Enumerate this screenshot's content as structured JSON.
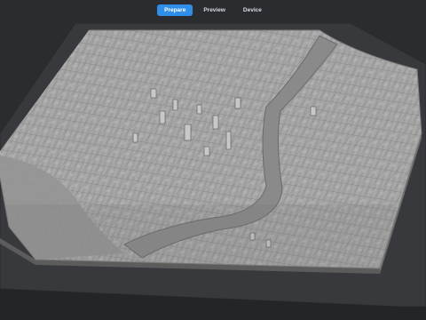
{
  "toolbar": {
    "tabs": [
      {
        "label": "Prepare",
        "active": true
      },
      {
        "label": "Preview",
        "active": false
      },
      {
        "label": "Device",
        "active": false
      }
    ]
  },
  "colors": {
    "background": "#2b2c30",
    "build_plate": "#3a3b3f",
    "plate_edge": "#222326",
    "model_surface": "#a3a3a3",
    "model_shadow": "#6d6d6d",
    "accent": "#2f8ee8"
  },
  "viewport": {
    "model": "3D city terrain model"
  }
}
